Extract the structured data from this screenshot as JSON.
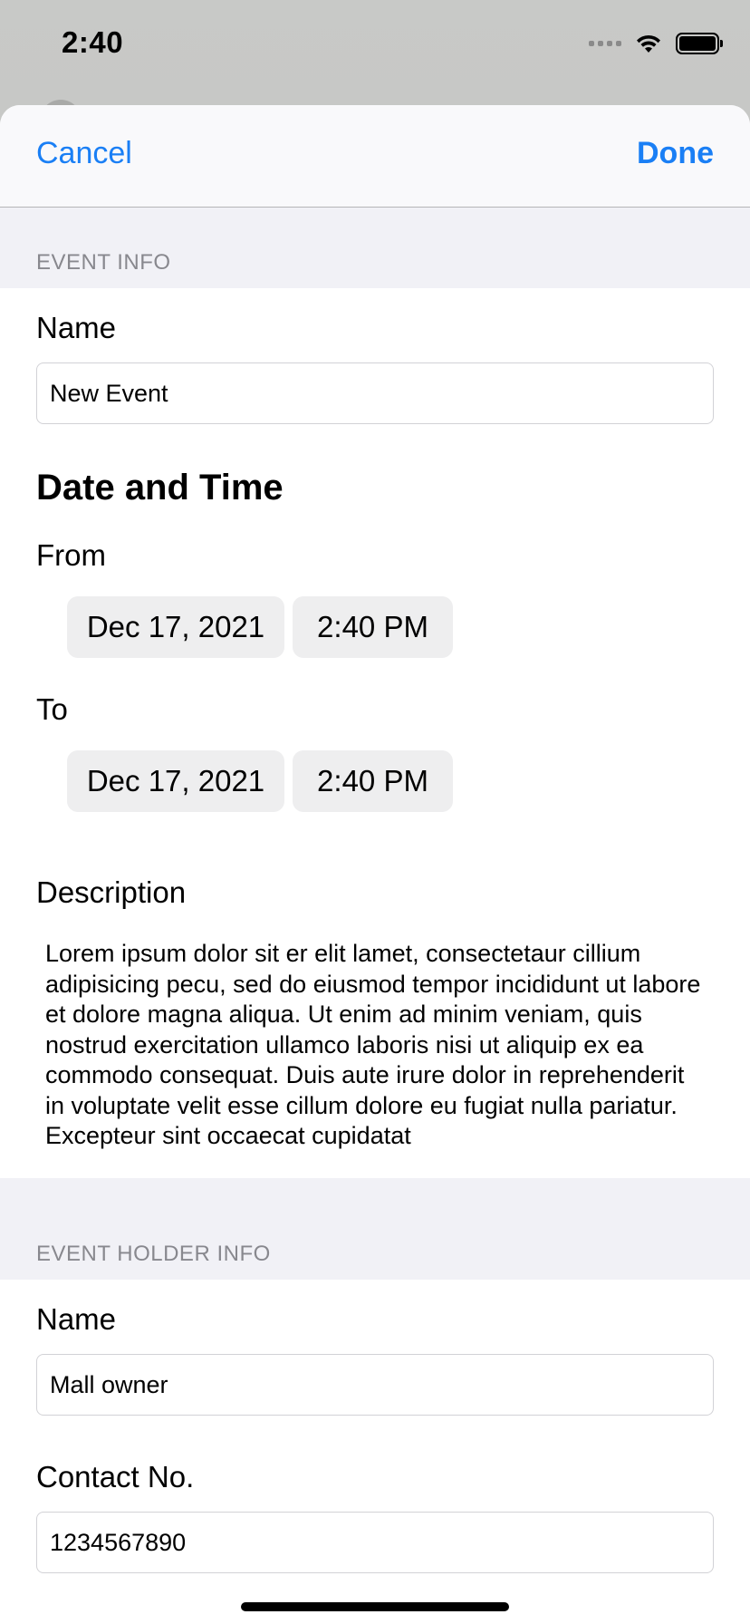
{
  "status_bar": {
    "time": "2:40"
  },
  "navbar": {
    "cancel_label": "Cancel",
    "done_label": "Done"
  },
  "event_info": {
    "header": "EVENT INFO",
    "name_label": "Name",
    "name_value": "New Event",
    "date_time_heading": "Date and Time",
    "from_label": "From",
    "from_date": "Dec 17, 2021",
    "from_time": "2:40 PM",
    "to_label": "To",
    "to_date": "Dec 17, 2021",
    "to_time": "2:40 PM",
    "description_label": "Description",
    "description_text": "Lorem ipsum dolor sit er elit lamet, consectetaur cillium adipisicing pecu, sed do eiusmod tempor incididunt ut labore et dolore magna aliqua. Ut enim ad minim veniam, quis nostrud exercitation ullamco laboris nisi ut aliquip ex ea commodo consequat. Duis aute irure dolor in reprehenderit in voluptate velit esse cillum dolore eu fugiat nulla pariatur. Excepteur sint occaecat cupidatat"
  },
  "event_holder_info": {
    "header": "EVENT HOLDER INFO",
    "name_label": "Name",
    "name_value": "Mall owner",
    "contact_label": "Contact No.",
    "contact_value": "1234567890"
  },
  "colors": {
    "accent": "#1a7ff5",
    "section_bg": "#f1f1f6",
    "pill_bg": "#eeeeef"
  }
}
